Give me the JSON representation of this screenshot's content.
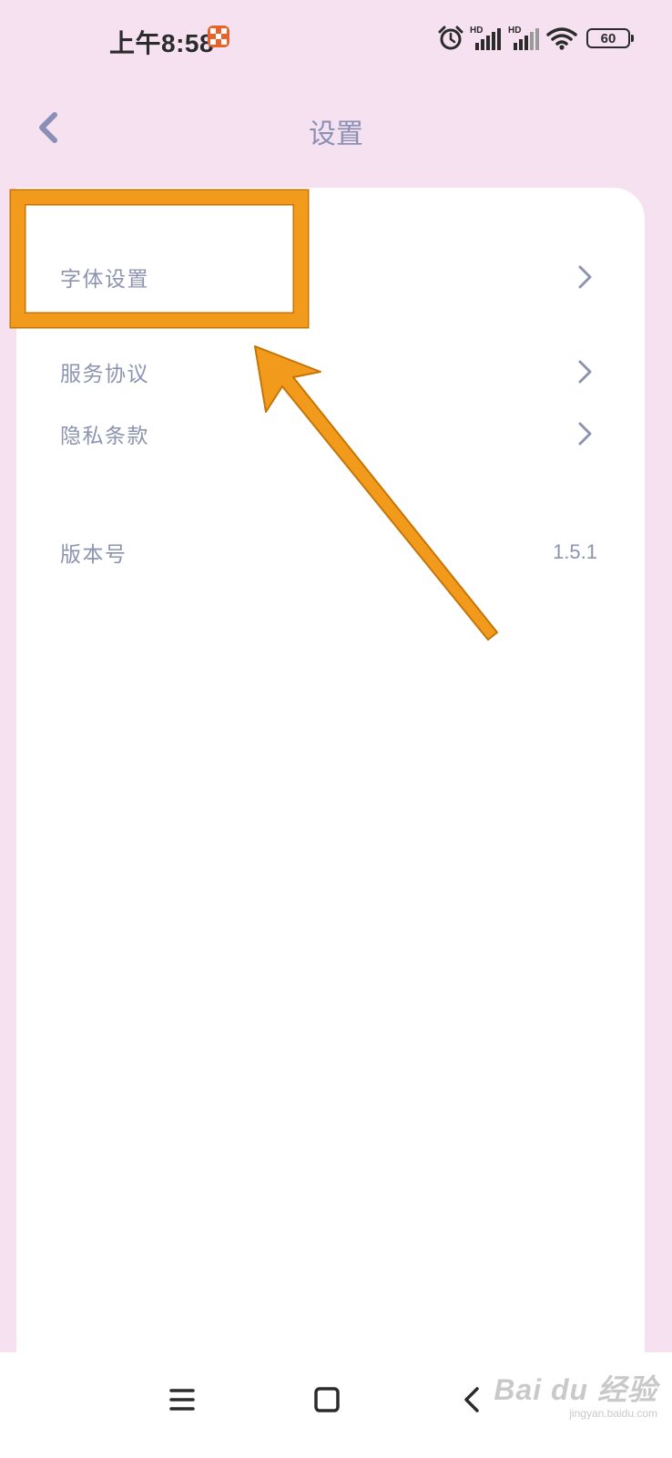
{
  "status_bar": {
    "time": "上午8:58",
    "app_badge_icon": "app-notification-icon",
    "alarm_icon": "alarm-icon",
    "signal_1_label": "HD",
    "signal_2_label": "HD",
    "wifi_icon": "wifi-icon",
    "battery_level": "60"
  },
  "header": {
    "back_icon": "chevron-left-icon",
    "title": "设置"
  },
  "settings": {
    "font_settings": "字体设置",
    "service_agreement": "服务协议",
    "privacy_policy": "隐私条款",
    "version_label": "版本号",
    "version_value": "1.5.1"
  },
  "annotation": {
    "highlight_color": "#f29a1c",
    "arrow_color": "#f29a1c"
  },
  "bottom_nav": {
    "menu_icon": "menu-icon",
    "home_icon": "home-icon",
    "back_icon": "back-icon"
  },
  "watermark": {
    "brand": "Bai du 经验",
    "site": "jingyan.baidu.com"
  },
  "colors": {
    "background": "#f5e1f0",
    "card": "#ffffff",
    "text_muted": "#8d94b0",
    "title": "#8a90b5",
    "accent": "#f29a1c"
  }
}
